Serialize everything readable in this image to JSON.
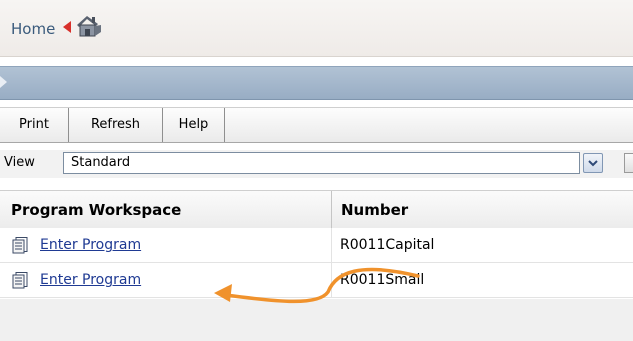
{
  "breadcrumb": {
    "home_label": "Home"
  },
  "toolbar": {
    "print_label": "Print",
    "refresh_label": "Refresh",
    "help_label": "Help"
  },
  "view": {
    "label": "View",
    "selected": "Standard"
  },
  "table": {
    "columns": [
      "Program Workspace",
      "Number"
    ],
    "rows": [
      {
        "program": "Enter Program",
        "number": "R0011Capital"
      },
      {
        "program": "Enter Program",
        "number": "R0011Small"
      }
    ]
  },
  "colors": {
    "link": "#1f3a93",
    "accent_arrow": "#f0922c",
    "header_bar": "#a6b8cc"
  }
}
